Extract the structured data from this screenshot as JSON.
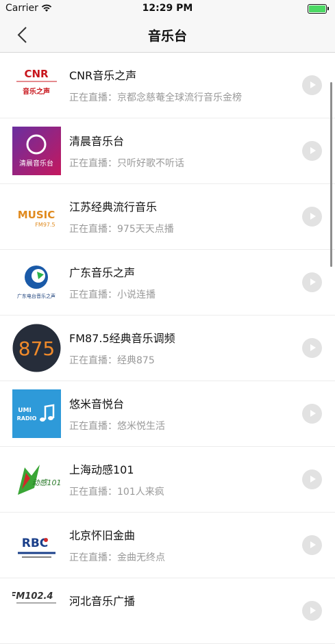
{
  "status_bar": {
    "carrier": "Carrier",
    "time": "12:29 PM"
  },
  "nav": {
    "title": "音乐台",
    "back_icon": "chevron-left-icon"
  },
  "live_prefix": "正在直播：",
  "stations": [
    {
      "name": "CNR音乐之声",
      "program": "京都念慈菴全球流行音乐金榜"
    },
    {
      "name": "清晨音乐台",
      "program": "只听好歌不听话"
    },
    {
      "name": "江苏经典流行音乐",
      "program": "975天天点播"
    },
    {
      "name": "广东音乐之声",
      "program": "小说连播"
    },
    {
      "name": "FM87.5经典音乐调频",
      "program": "经典875"
    },
    {
      "name": "悠米音悦台",
      "program": "悠米悦生活"
    },
    {
      "name": "上海动感101",
      "program": "101人来疯"
    },
    {
      "name": "北京怀旧金曲",
      "program": "金曲无终点"
    },
    {
      "name": "河北音乐广播",
      "program": ""
    }
  ],
  "logos": {
    "cnr": {
      "top": "CNR",
      "bottom": "音乐之声"
    },
    "qc": {
      "text": "清晨音乐台"
    },
    "js": {
      "text": "MUSIC",
      "sub": "FM97.5"
    },
    "gd": {
      "text": "广东电台音乐之声"
    },
    "fm875": {
      "text": "875"
    },
    "umi": {
      "text": "UMI",
      "sub": "RADIO"
    },
    "sh": {
      "text": "动感101"
    },
    "bj": {
      "text": "RBC"
    },
    "hb": {
      "text": "FM102.4"
    }
  },
  "colors": {
    "play_button": "#e2e2e2",
    "subtitle": "#999999",
    "battery": "#4cd964"
  }
}
